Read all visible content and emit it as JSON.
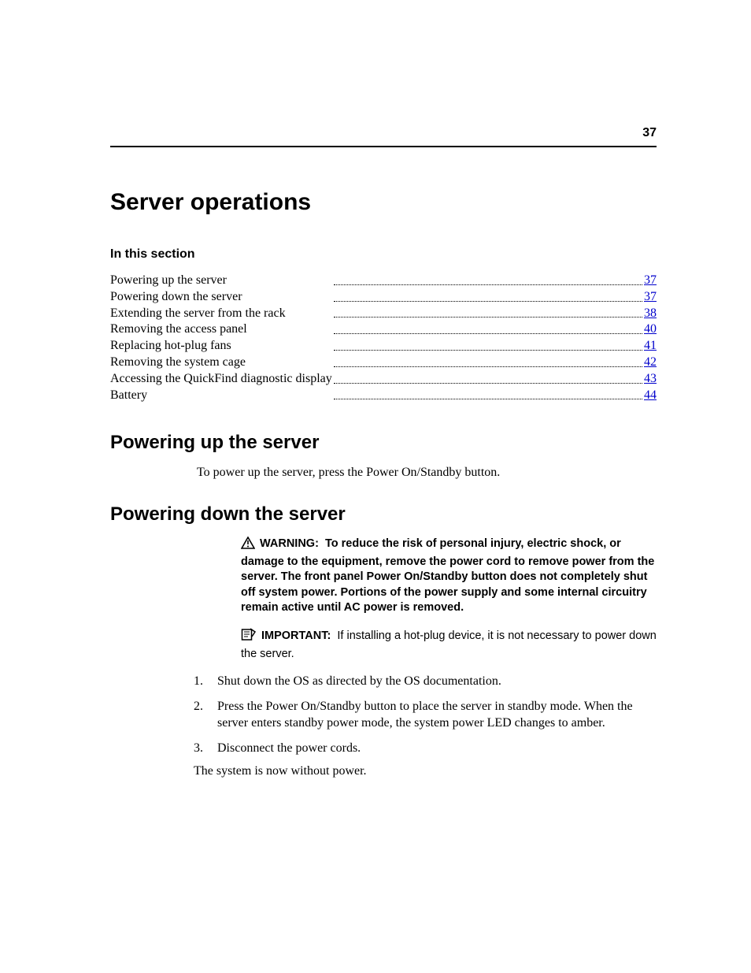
{
  "page_number": "37",
  "title": "Server operations",
  "in_this_section_label": "In this section",
  "toc": [
    {
      "label": "Powering up the server",
      "page": "37"
    },
    {
      "label": "Powering down the server",
      "page": "37"
    },
    {
      "label": "Extending the server from the rack",
      "page": "38"
    },
    {
      "label": "Removing the access panel",
      "page": "40"
    },
    {
      "label": "Replacing hot-plug fans",
      "page": "41"
    },
    {
      "label": "Removing the system cage",
      "page": "42"
    },
    {
      "label": "Accessing the QuickFind diagnostic display",
      "page": "43"
    },
    {
      "label": "Battery",
      "page": "44"
    }
  ],
  "section_up": {
    "heading": "Powering up the server",
    "body": "To power up the server, press the Power On/Standby button."
  },
  "section_down": {
    "heading": "Powering down the server",
    "warning_label": "WARNING:",
    "warning_body": "To reduce the risk of personal injury, electric shock, or damage to the equipment, remove the power cord to remove power from the server. The front panel Power On/Standby button does not completely shut off system power. Portions of the power supply and some internal circuitry remain active until AC power is removed.",
    "important_label": "IMPORTANT:",
    "important_body": "If installing a hot-plug device, it is not necessary to power down the server.",
    "steps": [
      "Shut down the OS as directed by the OS documentation.",
      "Press the Power On/Standby button to place the server in standby mode. When the server enters standby power mode, the system power LED changes to amber.",
      "Disconnect the power cords."
    ],
    "closing": "The system is now without power."
  }
}
